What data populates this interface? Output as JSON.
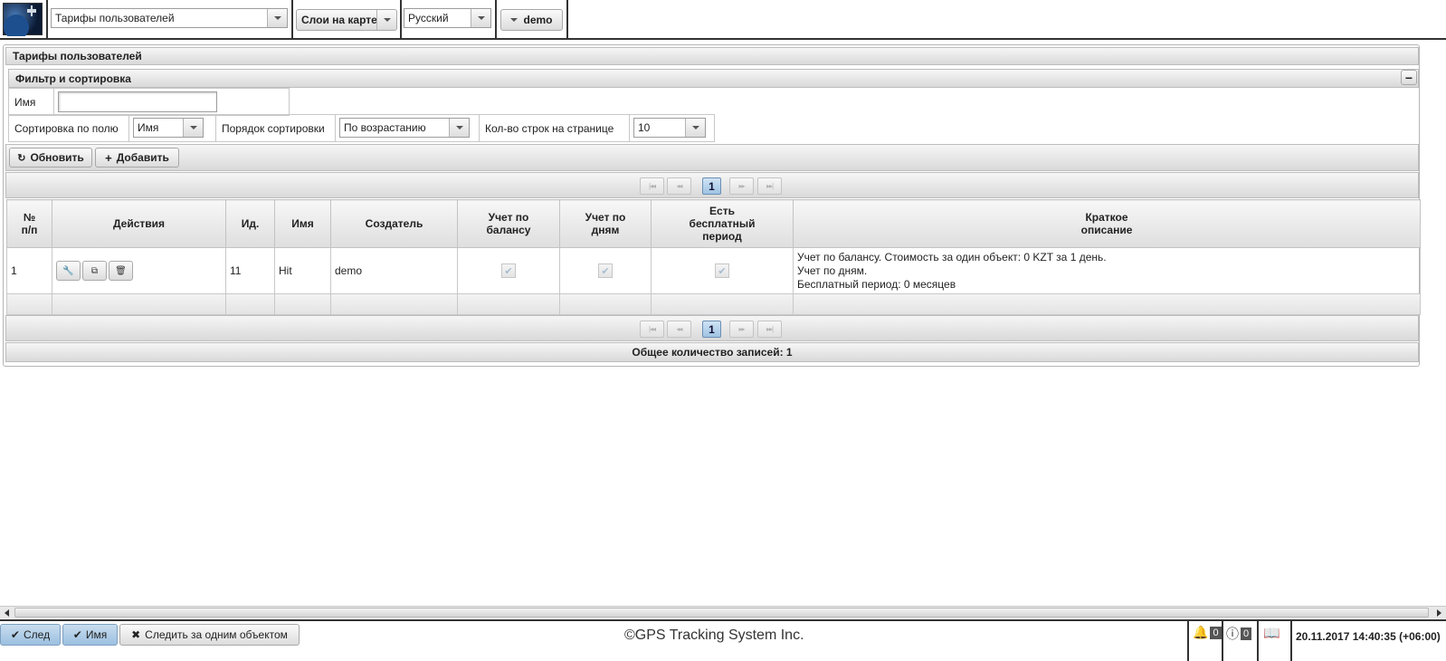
{
  "topbar": {
    "module_select": "Тарифы пользователей",
    "layers_button": "Слои на карте",
    "language_select": "Русский",
    "user_button": "demo"
  },
  "panel": {
    "title": "Тарифы пользователей",
    "filter_title": "Фильтр и сортировка",
    "collapse_glyph": "−"
  },
  "filter": {
    "name_label": "Имя",
    "name_value": "",
    "sort_field_label": "Сортировка по полю",
    "sort_field_value": "Имя",
    "sort_order_label": "Порядок сортировки",
    "sort_order_value": "По возрастанию",
    "rows_label": "Кол-во строк на странице",
    "rows_value": "10"
  },
  "toolbar": {
    "refresh_label": "Обновить",
    "add_label": "Добавить"
  },
  "pager": {
    "first": "|◂◂",
    "prev": "◂◂",
    "current": "1",
    "next": "▸▸",
    "last": "▸▸|"
  },
  "table": {
    "headers": {
      "num": "№ п/п",
      "actions": "Действия",
      "id": "Ид.",
      "name": "Имя",
      "creator": "Создатель",
      "balance": "Учет по балансу",
      "days": "Учет по дням",
      "free": "Есть бесплатный период",
      "desc": "Краткое описание"
    },
    "rows": [
      {
        "num": "1",
        "id": "11",
        "name": "Hit",
        "creator": "demo",
        "balance": true,
        "days": true,
        "free": true,
        "desc_line1": "Учет по балансу. Стоимость за один объект: 0 KZT за 1 день.",
        "desc_line2": "Учет по дням.",
        "desc_line3": "Бесплатный период: 0 месяцев"
      }
    ]
  },
  "total_records": "Общее количество записей: 1",
  "bottombar": {
    "next_label": "След",
    "name_label": "Имя",
    "follow_label": "Следить за одним объектом",
    "copyright": "©GPS Tracking System Inc.",
    "notifications_count": "0",
    "info_count": "0",
    "datetime": "20.11.2017 14:40:35 (+06:00)"
  }
}
